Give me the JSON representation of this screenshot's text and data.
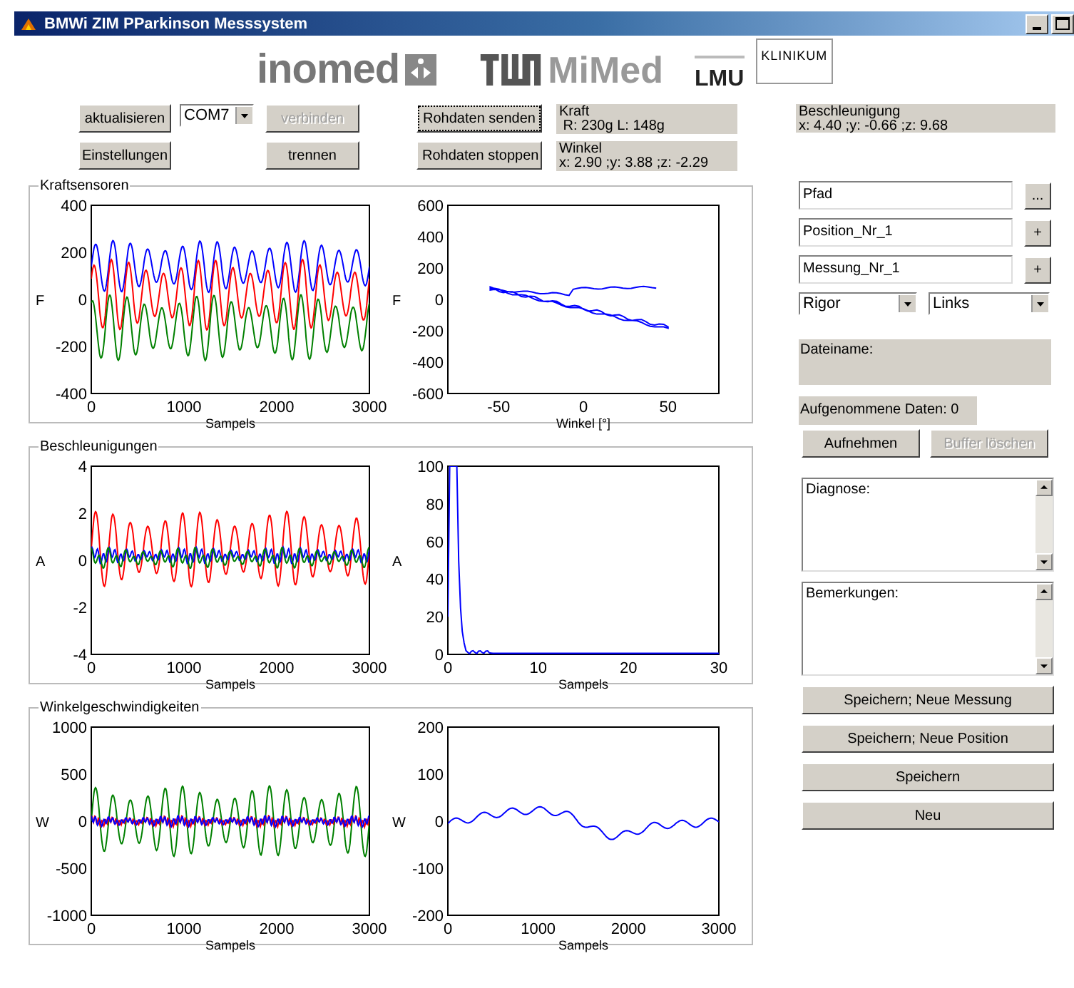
{
  "window": {
    "title": "BMWi ZIM PParkinson Messsystem"
  },
  "logos": {
    "inomed": "inomed",
    "mimed": "MiMed",
    "lmu": "LMU",
    "klinikum": "KLINIKUM"
  },
  "controls": {
    "aktualisieren": "aktualisieren",
    "port": "COM7",
    "verbinden": {
      "label": "verbinden",
      "disabled": true
    },
    "einstellungen": "Einstellungen",
    "trennen": {
      "label": "trennen",
      "disabled": false
    },
    "senden": {
      "label": "Rohdaten senden",
      "focused": true
    },
    "stoppen": "Rohdaten stoppen"
  },
  "readouts": [
    {
      "title": "Kraft",
      "value": " R: 230g L: 148g"
    },
    {
      "title": "Winkel",
      "value": "x: 2.90 ;y: 3.88 ;z: -2.29"
    },
    {
      "title": "Beschleunigung",
      "value": "x: 4.40 ;y: -0.66 ;z: 9.68"
    }
  ],
  "panels": [
    {
      "title": "Kraftsensoren",
      "plots": [
        {
          "kind": "oscillation",
          "ylabel": "F",
          "xlabel": "Sampels",
          "yticks": [
            "400",
            "200",
            "0",
            "-200",
            "-400"
          ],
          "xticks": [
            "0",
            "1000",
            "2000",
            "3000"
          ],
          "traces": [
            {
              "color": "#0000ff"
            },
            {
              "color": "#ff0000"
            },
            {
              "color": "#008000"
            }
          ]
        },
        {
          "kind": "loop",
          "ylabel": "F",
          "xlabel": "Winkel [°]",
          "yticks": [
            "600",
            "400",
            "200",
            "0",
            "-200",
            "-400",
            "-600"
          ],
          "xticks": [
            "-50",
            "0",
            "50"
          ],
          "traces": [
            {
              "color": "#0000ff"
            }
          ]
        }
      ]
    },
    {
      "title": "Beschleunigungen",
      "plots": [
        {
          "kind": "oscillation",
          "ylabel": "A",
          "xlabel": "Sampels",
          "yticks": [
            "4",
            "2",
            "0",
            "-2",
            "-4"
          ],
          "xticks": [
            "0",
            "1000",
            "2000",
            "3000"
          ],
          "traces": [
            {
              "color": "#ff0000"
            },
            {
              "color": "#0000ff"
            },
            {
              "color": "#008000"
            }
          ]
        },
        {
          "kind": "spectrum",
          "ylabel": "A",
          "xlabel": "Sampels",
          "yticks": [
            "100",
            "80",
            "60",
            "40",
            "20",
            "0"
          ],
          "xticks": [
            "0",
            "10",
            "20",
            "30"
          ],
          "traces": [
            {
              "color": "#0000ff"
            }
          ]
        }
      ]
    },
    {
      "title": "Winkelgeschwindigkeiten",
      "plots": [
        {
          "kind": "oscillation",
          "ylabel": "W",
          "xlabel": "Sampels",
          "yticks": [
            "1000",
            "500",
            "0",
            "-500",
            "-1000"
          ],
          "xticks": [
            "0",
            "1000",
            "2000",
            "3000"
          ],
          "traces": [
            {
              "color": "#008000"
            },
            {
              "color": "#ff0000"
            },
            {
              "color": "#0000ff"
            }
          ]
        },
        {
          "kind": "drift",
          "ylabel": "W",
          "xlabel": "Sampels",
          "yticks": [
            "200",
            "100",
            "0",
            "-100",
            "-200"
          ],
          "xticks": [
            "0",
            "1000",
            "2000",
            "3000"
          ],
          "traces": [
            {
              "color": "#0000ff"
            }
          ]
        }
      ]
    }
  ],
  "side": {
    "path": {
      "value": "Pfad",
      "button": "..."
    },
    "position": {
      "value": "Position_Nr_1",
      "button": "+"
    },
    "messung": {
      "value": "Messung_Nr_1",
      "button": "+"
    },
    "type": "Rigor",
    "side": "Links",
    "dateiname": "Dateiname:",
    "aufgenommen": "Aufgenommene Daten: 0",
    "aufnehmen": "Aufnehmen",
    "buffer": {
      "label": "Buffer löschen",
      "disabled": true
    },
    "diagnose": "Diagnose:",
    "bemerkungen": "Bemerkungen:",
    "buttons": [
      "Speichern; Neue Messung",
      "Speichern; Neue Position",
      "Speichern",
      "Neu"
    ]
  }
}
